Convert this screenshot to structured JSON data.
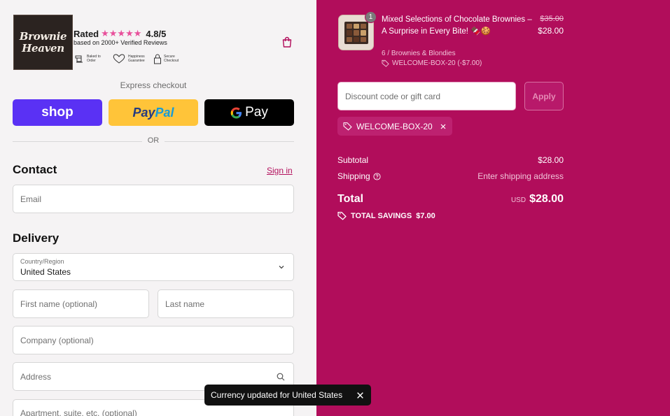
{
  "brand": {
    "logo_line1": "Brownie",
    "logo_line2": "Heaven"
  },
  "rating": {
    "prefix": "Rated",
    "stars": "★★★★★",
    "score": "4.8/5",
    "reviews": "based on 2000+ Verified Reviews",
    "badges": [
      {
        "icon": "mixer-icon",
        "label": "Baked to Order"
      },
      {
        "icon": "heart-icon",
        "label": "Happiness Guarantee"
      },
      {
        "icon": "lock-icon",
        "label": "Secure Checkout"
      }
    ]
  },
  "express": {
    "title": "Express checkout",
    "shop_label": "shop",
    "paypal_a": "Pay",
    "paypal_b": "Pal",
    "gpay_label": "Pay",
    "or_text": "OR"
  },
  "contact": {
    "title": "Contact",
    "signin": "Sign in",
    "email_placeholder": "Email"
  },
  "delivery": {
    "title": "Delivery",
    "country_label": "Country/Region",
    "country_value": "United States",
    "first_name": "First name (optional)",
    "last_name": "Last name",
    "company": "Company (optional)",
    "address": "Address",
    "apartment": "Apartment, suite, etc. (optional)"
  },
  "order": {
    "quantity": "1",
    "product_name": "Mixed Selections of Chocolate Brownies – A Surprise in Every Bite! 🍫🍪",
    "old_price": "$35.00",
    "price": "$28.00",
    "variant": "6 / Brownies & Blondies",
    "item_discount": "WELCOME-BOX-20 (-$7.00)",
    "discount_placeholder": "Discount code or gift card",
    "apply_label": "Apply",
    "applied_code": "WELCOME-BOX-20",
    "subtotal_label": "Subtotal",
    "subtotal_value": "$28.00",
    "shipping_label": "Shipping",
    "shipping_value": "Enter shipping address",
    "total_label": "Total",
    "currency": "USD",
    "total_value": "$28.00",
    "savings_label": "TOTAL SAVINGS",
    "savings_value": "$7.00"
  },
  "toast": {
    "message": "Currency updated for United States"
  },
  "colors": {
    "accent": "#b10d5b",
    "shop": "#5a31f4",
    "paypal": "#ffc439",
    "star": "#e8509b"
  }
}
